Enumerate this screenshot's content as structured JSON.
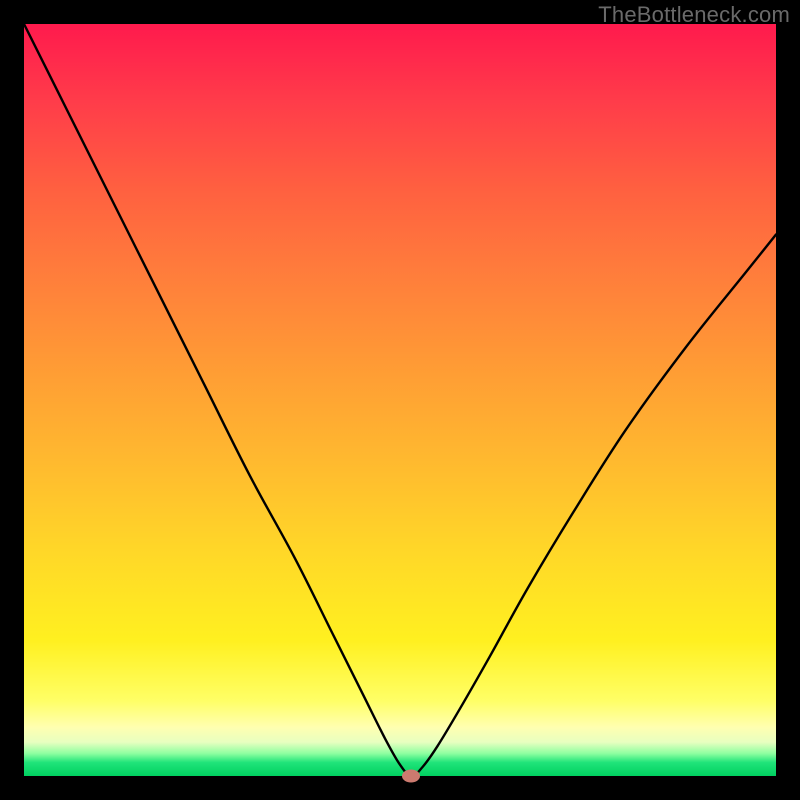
{
  "watermark": "TheBottleneck.com",
  "chart_data": {
    "type": "line",
    "title": "",
    "xlabel": "",
    "ylabel": "",
    "xlim": [
      0,
      100
    ],
    "ylim": [
      0,
      100
    ],
    "grid": false,
    "legend": false,
    "series": [
      {
        "name": "bottleneck-curve",
        "x": [
          0,
          6,
          12,
          18,
          24,
          30,
          36,
          41,
          45,
          48,
          50,
          51.5,
          53,
          55,
          58,
          62,
          67,
          73,
          80,
          88,
          96,
          100
        ],
        "y": [
          100,
          88,
          76,
          64,
          52,
          40,
          29,
          19,
          11,
          5,
          1.5,
          0,
          1.2,
          4,
          9,
          16,
          25,
          35,
          46,
          57,
          67,
          72
        ]
      }
    ],
    "annotations": [
      {
        "name": "optimal-marker",
        "x": 51.5,
        "y": 0,
        "shape": "ellipse",
        "color": "#cc7a6f"
      }
    ],
    "background_gradient": {
      "top": "#ff1a4d",
      "mid": "#ffd728",
      "bottom": "#00d060"
    }
  }
}
